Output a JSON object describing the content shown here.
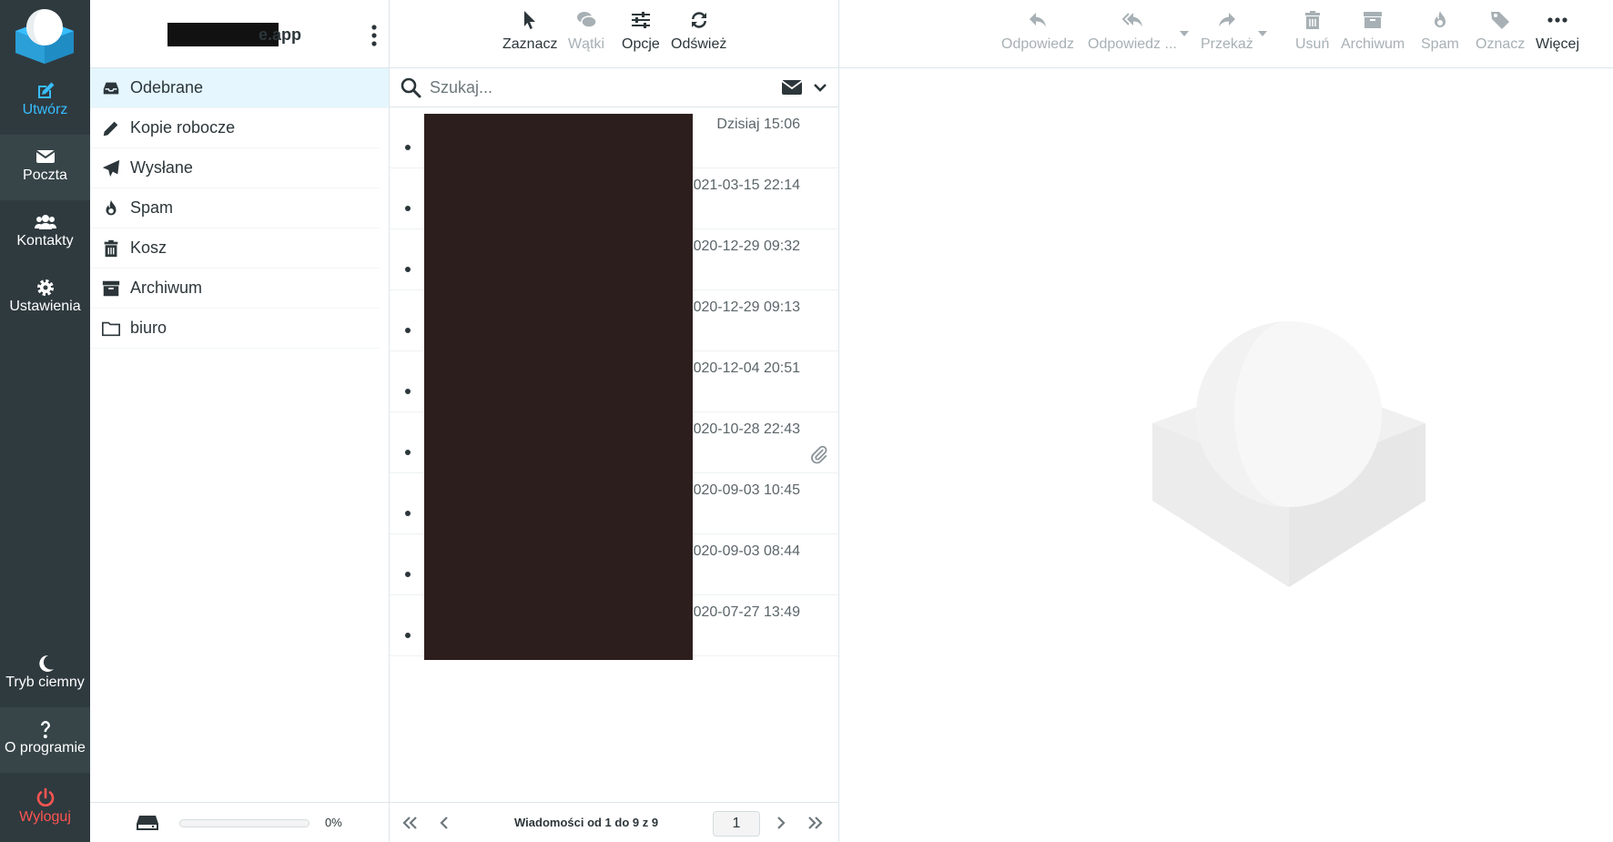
{
  "taskbar": {
    "compose": "Utwórz",
    "mail": "Poczta",
    "contacts": "Kontakty",
    "settings": "Ustawienia",
    "dark_mode": "Tryb ciemny",
    "about": "O programie",
    "logout": "Wyloguj"
  },
  "account": {
    "name_suffix": "e.app"
  },
  "folders": [
    {
      "label": "Odebrane",
      "icon": "inbox-icon"
    },
    {
      "label": "Kopie robocze",
      "icon": "pencil-icon"
    },
    {
      "label": "Wysłane",
      "icon": "paper-plane-icon"
    },
    {
      "label": "Spam",
      "icon": "fire-icon"
    },
    {
      "label": "Kosz",
      "icon": "trash-icon"
    },
    {
      "label": "Archiwum",
      "icon": "archive-icon"
    },
    {
      "label": "biuro",
      "icon": "folder-icon"
    }
  ],
  "quota": {
    "text": "0%",
    "fraction": 0
  },
  "list_toolbar": {
    "select": "Zaznacz",
    "threads": "Wątki",
    "options": "Opcje",
    "refresh": "Odśwież"
  },
  "search": {
    "placeholder": "Szukaj..."
  },
  "messages": [
    {
      "date": "Dzisiaj 15:06",
      "attachment": false
    },
    {
      "date": "2021-03-15 22:14",
      "attachment": false
    },
    {
      "date": "2020-12-29 09:32",
      "attachment": false
    },
    {
      "date": "2020-12-29 09:13",
      "attachment": false
    },
    {
      "date": "2020-12-04 20:51",
      "attachment": false
    },
    {
      "date": "2020-10-28 22:43",
      "attachment": true
    },
    {
      "date": "2020-09-03 10:45",
      "attachment": false
    },
    {
      "date": "2020-09-03 08:44",
      "attachment": false
    },
    {
      "date": "2020-07-27 13:49",
      "attachment": false
    }
  ],
  "list_footer": {
    "count": "Wiadomości od 1 do 9 z 9",
    "page": "1"
  },
  "preview_toolbar": {
    "reply": "Odpowiedz",
    "reply_all": "Odpowiedz ...",
    "forward": "Przekaż",
    "delete": "Usuń",
    "archive": "Archiwum",
    "spam": "Spam",
    "mark": "Oznacz",
    "more": "Więcej"
  },
  "colors": {
    "taskbar_bg": "#2f3a3f",
    "accent": "#37beff",
    "logout": "#ff5552",
    "active_folder_bg": "#e5f6ff"
  }
}
